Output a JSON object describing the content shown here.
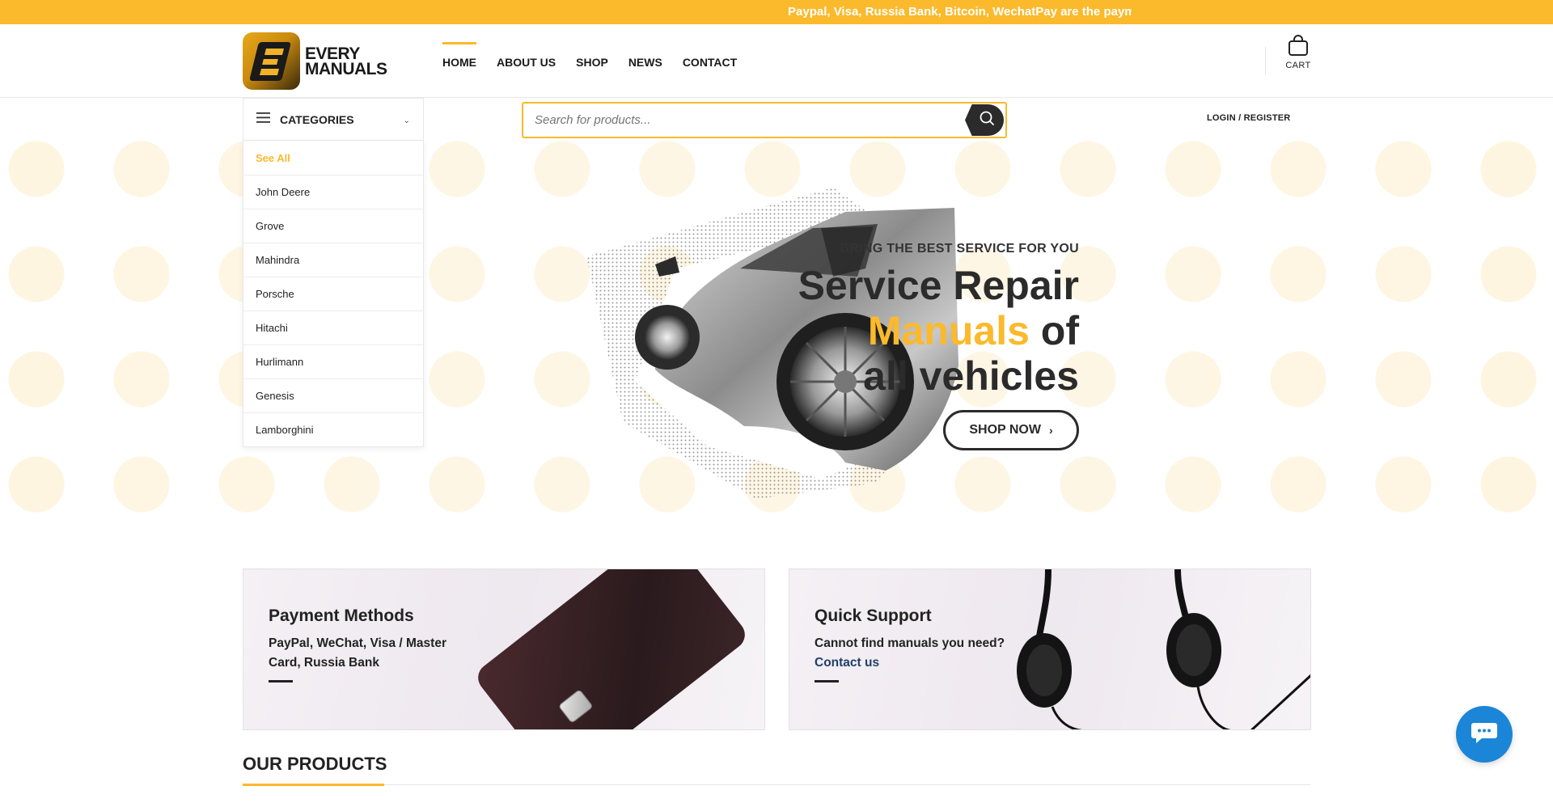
{
  "announcement": "Paypal, Visa, Russia Bank, Bitcoin, WechatPay are the paymer",
  "logo": {
    "line1": "EVERY",
    "line2": "MANUALS"
  },
  "nav": [
    {
      "label": "HOME",
      "active": true
    },
    {
      "label": "ABOUT US"
    },
    {
      "label": "SHOP"
    },
    {
      "label": "NEWS"
    },
    {
      "label": "CONTACT"
    }
  ],
  "cart": {
    "label": "CART",
    "icon": "shopping-bag-icon"
  },
  "categories": {
    "title": "CATEGORIES",
    "items": [
      "See All",
      "John Deere",
      "Grove",
      "Mahindra",
      "Porsche",
      "Hitachi",
      "Hurlimann",
      "Genesis",
      "Lamborghini"
    ]
  },
  "search": {
    "placeholder": "Search for products...",
    "icon": "search-icon"
  },
  "login": "LOGIN / REGISTER",
  "hero": {
    "kicker": "BRING THE BEST SERVICE FOR YOU",
    "line1": "Service Repair",
    "line2_accent": "Manuals",
    "line2_rest": " of",
    "line3": "all vehicles",
    "cta": "SHOP NOW",
    "accent_color": "#fbb92c"
  },
  "promos": [
    {
      "title": "Payment Methods",
      "desc": "PayPal, WeChat, Visa / Master Card, Russia Bank"
    },
    {
      "title": "Quick Support",
      "desc_prefix": "Cannot find manuals you need? ",
      "link": "Contact us"
    }
  ],
  "section": {
    "title": "OUR PRODUCTS"
  },
  "chat": {
    "icon": "chat-bubble-icon"
  },
  "colors": {
    "brand_yellow": "#fbb92c",
    "dark": "#2b2b2b",
    "chat_blue": "#1b86d8"
  }
}
